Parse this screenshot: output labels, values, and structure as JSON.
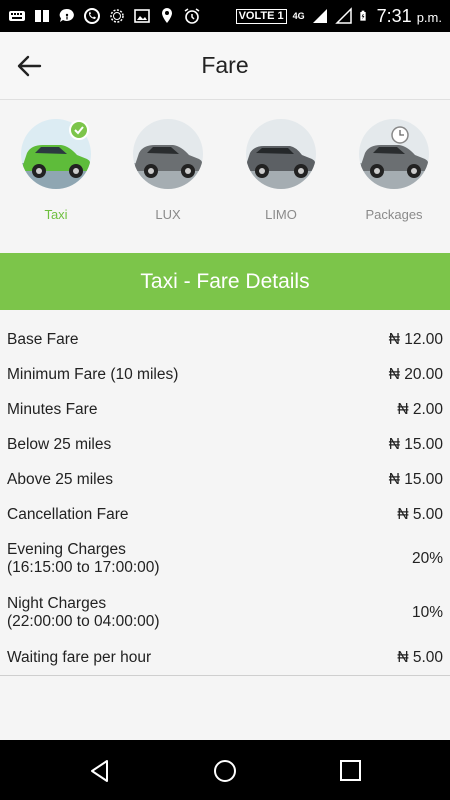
{
  "status_bar": {
    "volte": "VOLTE 1",
    "network": "4G",
    "time": "7:31",
    "ampm": "p.m."
  },
  "appbar": {
    "title": "Fare"
  },
  "vehicle_types": [
    {
      "label": "Taxi",
      "selected": true
    },
    {
      "label": "LUX",
      "selected": false
    },
    {
      "label": "LIMO",
      "selected": false
    },
    {
      "label": "Packages",
      "selected": false
    }
  ],
  "banner": {
    "title": "Taxi -  Fare Details"
  },
  "fares": [
    {
      "label": "Base Fare",
      "value": "₦ 12.00"
    },
    {
      "label": "Minimum Fare (10 miles)",
      "value": "₦ 20.00"
    },
    {
      "label": "Minutes Fare",
      "value": "₦ 2.00"
    },
    {
      "label": "Below 25 miles",
      "value": "₦ 15.00"
    },
    {
      "label": "Above 25 miles",
      "value": "₦ 15.00"
    },
    {
      "label": "Cancellation Fare",
      "value": "₦ 5.00"
    },
    {
      "label": "Evening Charges",
      "sub": "(16:15:00 to 17:00:00)",
      "value": "20%"
    },
    {
      "label": "Night Charges",
      "sub": "(22:00:00 to 04:00:00)",
      "value": "10%"
    },
    {
      "label": "Waiting fare per hour",
      "value": "₦ 5.00"
    }
  ],
  "colors": {
    "accent": "#7cc54a",
    "status_bar": "#000000"
  }
}
